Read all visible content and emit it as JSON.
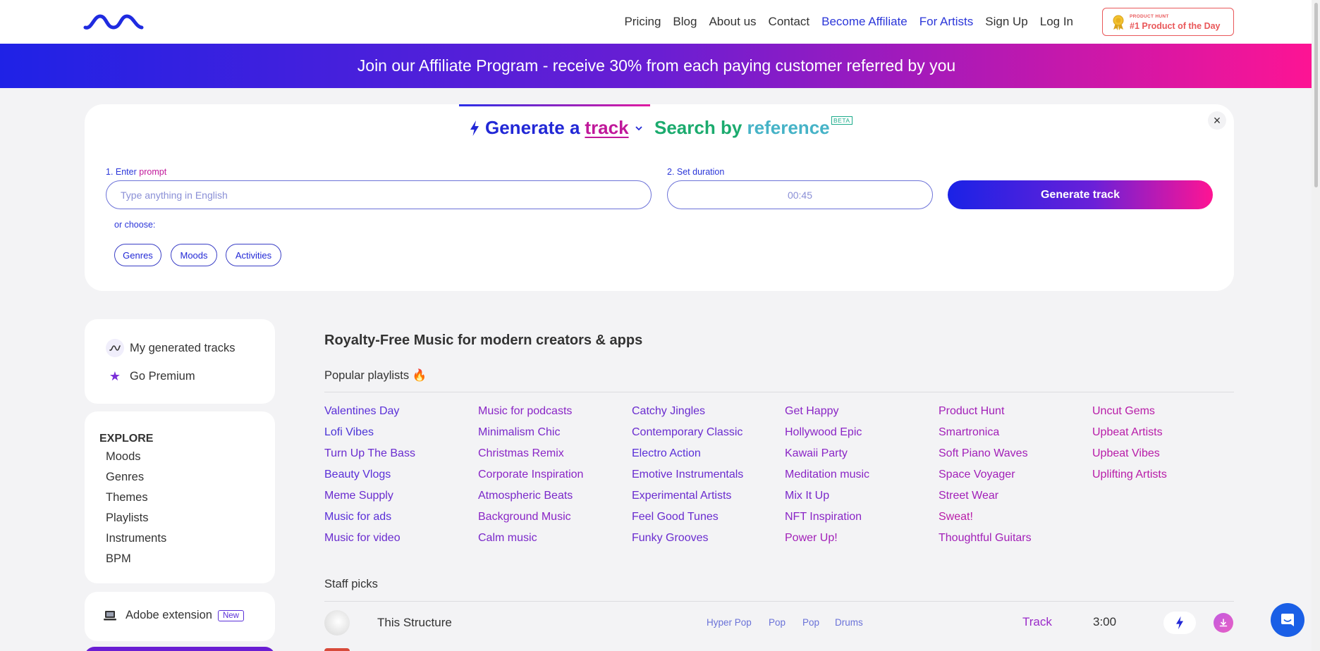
{
  "nav": {
    "links": [
      {
        "label": "Pricing",
        "style": "dark"
      },
      {
        "label": "Blog",
        "style": "dark"
      },
      {
        "label": "About us",
        "style": "dark"
      },
      {
        "label": "Contact",
        "style": "dark"
      },
      {
        "label": "Become Affiliate",
        "style": "blue"
      },
      {
        "label": "For Artists",
        "style": "blue"
      },
      {
        "label": "Sign Up",
        "style": "dark"
      },
      {
        "label": "Log In",
        "style": "dark"
      }
    ],
    "badge_small": "PRODUCT HUNT",
    "badge_big": "#1 Product of the Day"
  },
  "banner": {
    "text": "Join our Affiliate Program - receive 30% from each paying customer referred by you"
  },
  "generator": {
    "tab_prefix": "Generate a",
    "tab_word": "track",
    "search_tab_1": "Search by",
    "search_tab_2": "reference",
    "beta_label": "BETA",
    "close_glyph": "×",
    "prompt_label_num": "1. Enter",
    "prompt_label_word": "prompt",
    "prompt_placeholder": "Type anything in English",
    "duration_label": "2. Set duration",
    "duration_value": "00:45",
    "button_label": "Generate track",
    "or_choose": "or choose:",
    "chips": [
      "Genres",
      "Moods",
      "Activities"
    ]
  },
  "sidebar": {
    "my_tracks": "My generated tracks",
    "go_premium": "Go Premium",
    "explore_title": "EXPLORE",
    "explore_items": [
      "Moods",
      "Genres",
      "Themes",
      "Playlists",
      "Instruments",
      "BPM"
    ],
    "adobe_label": "Adobe extension",
    "new_badge": "New"
  },
  "main": {
    "title": "Royalty-Free Music for modern creators & apps",
    "popular_title": "Popular playlists 🔥",
    "playlist_columns": [
      [
        "Valentines Day",
        "Lofi Vibes",
        "Turn Up The Bass",
        "Beauty Vlogs",
        "Meme Supply",
        "Music for ads",
        "Music for video"
      ],
      [
        "Music for podcasts",
        "Minimalism Chic",
        "Christmas Remix",
        "Corporate Inspiration",
        "Atmospheric Beats",
        "Background Music",
        "Calm music"
      ],
      [
        "Catchy Jingles",
        "Contemporary Classic",
        "Electro Action",
        "Emotive Instrumentals",
        "Experimental Artists",
        "Feel Good Tunes",
        "Funky Grooves"
      ],
      [
        "Get Happy",
        "Hollywood Epic",
        "Kawaii Party",
        "Meditation music",
        "Mix It Up",
        "NFT Inspiration",
        "Power Up!"
      ],
      [
        "Product Hunt",
        "Smartronica",
        "Soft Piano Waves",
        "Space Voyager",
        "Street Wear",
        "Sweat!",
        "Thoughtful Guitars"
      ],
      [
        "Uncut Gems",
        "Upbeat Artists",
        "Upbeat Vibes",
        "Uplifting Artists"
      ]
    ],
    "staff_title": "Staff picks",
    "track": {
      "title": "This Structure",
      "tags": [
        "Hyper Pop",
        "Pop",
        "Pop",
        "Drums"
      ],
      "type": "Track",
      "duration": "3:00"
    }
  },
  "colors": {
    "accent_blue": "#2228d6",
    "accent_pink": "#c0189a",
    "link_blue": "#2b36d9",
    "link_pink": "#c21ba0"
  },
  "icons": {
    "logo": "wave-logo",
    "bolt": "lightning-icon",
    "download": "download-icon",
    "chat": "chat-icon"
  }
}
